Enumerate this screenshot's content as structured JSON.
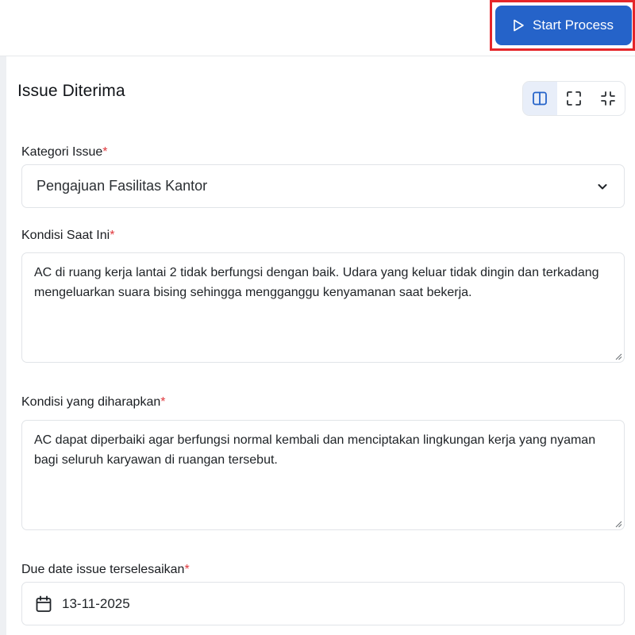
{
  "header": {
    "start_button_label": "Start Process"
  },
  "panel": {
    "title": "Issue Diterima",
    "view_modes": [
      "split-view",
      "expand",
      "collapse"
    ],
    "active_view_mode": "split-view"
  },
  "form": {
    "required_marker": "*",
    "kategori": {
      "label": "Kategori Issue",
      "value": "Pengajuan Fasilitas Kantor"
    },
    "kondisi_saat_ini": {
      "label": "Kondisi Saat Ini",
      "value": "AC di ruang kerja lantai 2 tidak berfungsi dengan baik. Udara yang keluar tidak dingin dan terkadang mengeluarkan suara bising sehingga mengganggu kenyamanan saat bekerja."
    },
    "kondisi_diharapkan": {
      "label": "Kondisi yang diharapkan",
      "value": "AC dapat diperbaiki agar berfungsi normal kembali dan menciptakan lingkungan kerja yang nyaman bagi seluruh karyawan di ruangan tersebut."
    },
    "due_date": {
      "label": "Due date issue terselesaikan",
      "value": "13-11-2025"
    }
  },
  "colors": {
    "primary": "#2563c9",
    "highlight": "#e5262a",
    "required": "#e0393e"
  }
}
